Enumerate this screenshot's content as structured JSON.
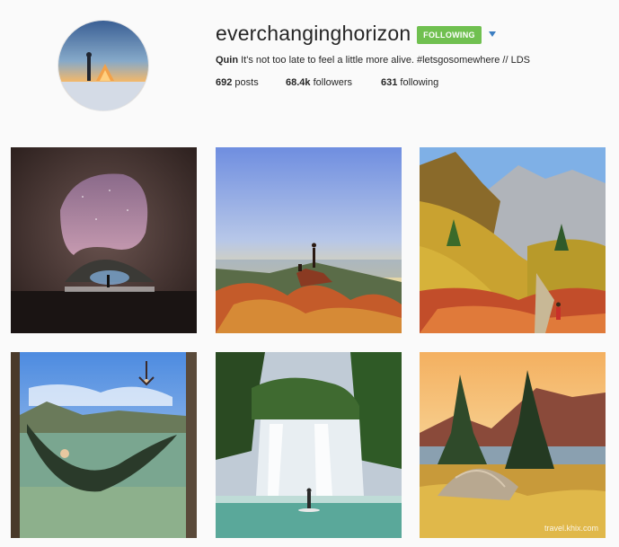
{
  "profile": {
    "username": "everchanginghorizon",
    "follow_label": "FOLLOWING",
    "bio_name": "Quin",
    "bio_text": "It's not too late to feel a little more alive. #letsgosomewhere // LDS",
    "stats": {
      "posts_count": "692",
      "posts_label": "posts",
      "followers_count": "68.4k",
      "followers_label": "followers",
      "following_count": "631",
      "following_label": "following"
    }
  },
  "icons": {
    "dropdown": "caret-down-icon"
  },
  "colors": {
    "follow_button": "#70c050",
    "caret": "#3d7fc2",
    "background": "#fafafa"
  },
  "watermark": "travel.khix.com",
  "posts": [
    {
      "description": "cave arch at night"
    },
    {
      "description": "person on rock at sunset"
    },
    {
      "description": "autumn mountain valley hike"
    },
    {
      "description": "hammock over lake"
    },
    {
      "description": "waterfall paddleboard"
    },
    {
      "description": "tent in golden meadow"
    }
  ]
}
